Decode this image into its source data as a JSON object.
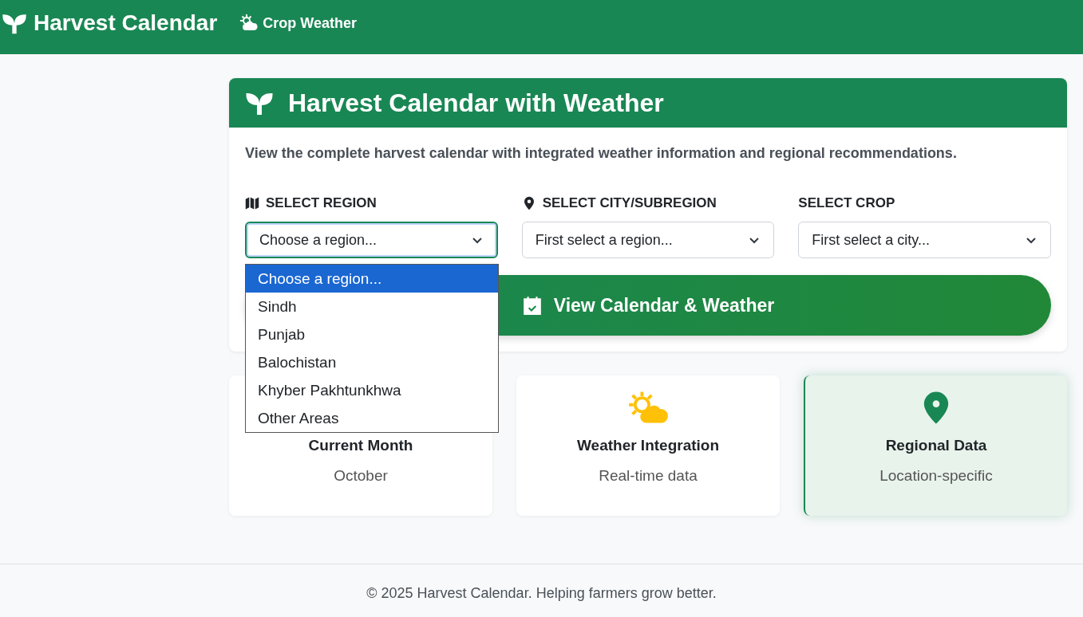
{
  "navbar": {
    "brand": "Harvest Calendar",
    "links": [
      {
        "label": "Crop Weather"
      }
    ]
  },
  "panel": {
    "title": "Harvest Calendar with Weather",
    "description": "View the complete harvest calendar with integrated weather information and regional recommendations.",
    "fields": [
      {
        "kind": "region",
        "label": "SELECT REGION",
        "value": "Choose a region...",
        "focused": true
      },
      {
        "kind": "city",
        "label": "SELECT CITY/SUBREGION",
        "value": "First select a region...",
        "focused": false
      },
      {
        "kind": "crop",
        "label": "SELECT CROP",
        "value": "First select a city...",
        "focused": false
      }
    ],
    "button": "View Calendar & Weather"
  },
  "dropdown": {
    "options": [
      {
        "label": "Choose a region...",
        "selected": true
      },
      {
        "label": "Sindh",
        "selected": false
      },
      {
        "label": "Punjab",
        "selected": false
      },
      {
        "label": "Balochistan",
        "selected": false
      },
      {
        "label": "Khyber Pakhtunkhwa",
        "selected": false
      },
      {
        "label": "Other Areas",
        "selected": false
      }
    ]
  },
  "features": [
    {
      "kind": "month",
      "title": "Current Month",
      "value": "October",
      "selected": false
    },
    {
      "kind": "weather",
      "title": "Weather Integration",
      "value": "Real-time data",
      "selected": false
    },
    {
      "kind": "region",
      "title": "Regional Data",
      "value": "Location-specific",
      "selected": true
    }
  ],
  "footer": "© 2025 Harvest Calendar. Helping farmers grow better."
}
